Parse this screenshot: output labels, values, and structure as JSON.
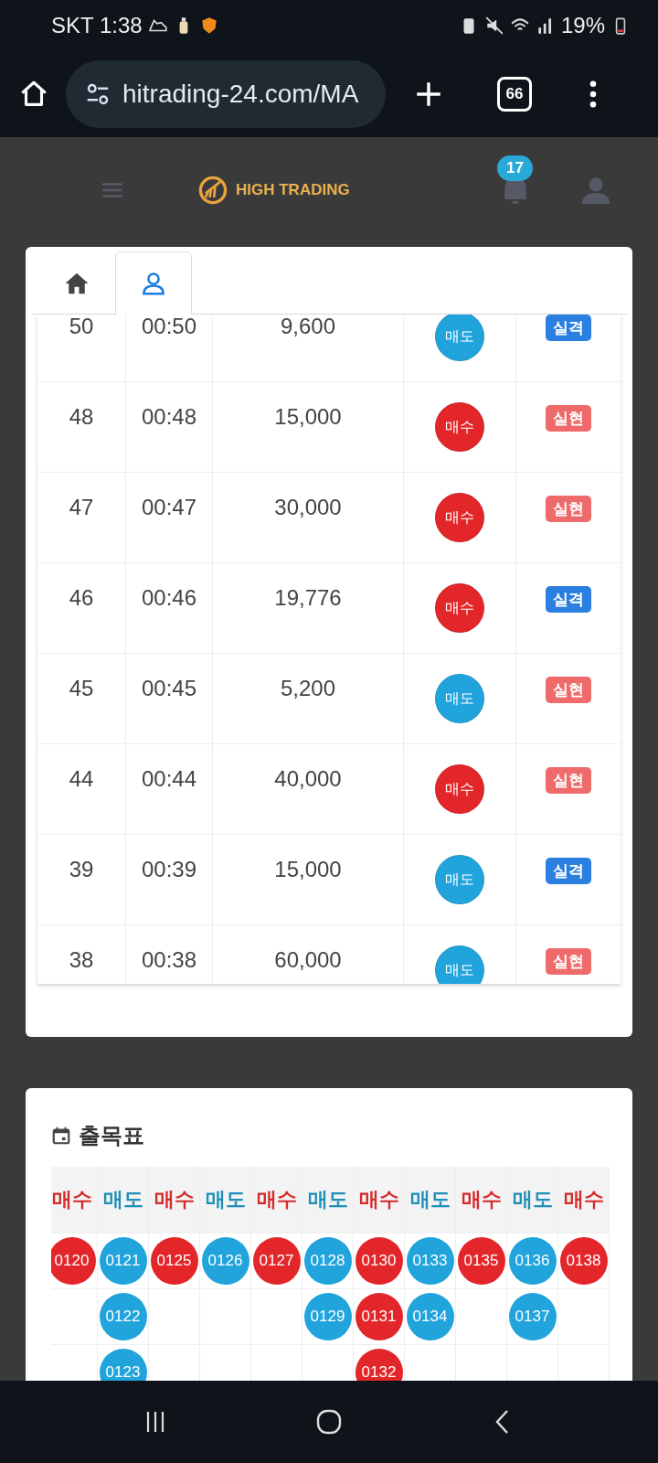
{
  "status_bar": {
    "carrier_time": "SKT 1:38",
    "battery": "19%"
  },
  "browser": {
    "url": "hitrading-24.com/MA",
    "tab_count": "66"
  },
  "header": {
    "brand": "HIGH TRADING",
    "notification_count": "17"
  },
  "tabs": [
    {
      "kind": "home",
      "selected": false
    },
    {
      "kind": "user",
      "selected": true
    }
  ],
  "trades": [
    {
      "no": "50",
      "time": "00:50",
      "amount": "9,600",
      "side": {
        "kind": "sell",
        "label": "매도"
      },
      "result": {
        "kind": "fail",
        "label": "실격"
      }
    },
    {
      "no": "48",
      "time": "00:48",
      "amount": "15,000",
      "side": {
        "kind": "buy",
        "label": "매수"
      },
      "result": {
        "kind": "hit",
        "label": "실현"
      }
    },
    {
      "no": "47",
      "time": "00:47",
      "amount": "30,000",
      "side": {
        "kind": "buy",
        "label": "매수"
      },
      "result": {
        "kind": "hit",
        "label": "실현"
      }
    },
    {
      "no": "46",
      "time": "00:46",
      "amount": "19,776",
      "side": {
        "kind": "buy",
        "label": "매수"
      },
      "result": {
        "kind": "fail",
        "label": "실격"
      }
    },
    {
      "no": "45",
      "time": "00:45",
      "amount": "5,200",
      "side": {
        "kind": "sell",
        "label": "매도"
      },
      "result": {
        "kind": "hit",
        "label": "실현"
      }
    },
    {
      "no": "44",
      "time": "00:44",
      "amount": "40,000",
      "side": {
        "kind": "buy",
        "label": "매수"
      },
      "result": {
        "kind": "hit",
        "label": "실현"
      }
    },
    {
      "no": "39",
      "time": "00:39",
      "amount": "15,000",
      "side": {
        "kind": "sell",
        "label": "매도"
      },
      "result": {
        "kind": "fail",
        "label": "실격"
      }
    },
    {
      "no": "38",
      "time": "00:38",
      "amount": "60,000",
      "side": {
        "kind": "sell",
        "label": "매도"
      },
      "result": {
        "kind": "hit",
        "label": "실현"
      }
    }
  ],
  "schedule": {
    "title": "출목표",
    "columns": [
      {
        "kind": "buy",
        "label": "매수",
        "cells": [
          "0120"
        ]
      },
      {
        "kind": "sell",
        "label": "매도",
        "cells": [
          "0121",
          "0122",
          "0123"
        ]
      },
      {
        "kind": "buy",
        "label": "매수",
        "cells": [
          "0125"
        ]
      },
      {
        "kind": "sell",
        "label": "매도",
        "cells": [
          "0126"
        ]
      },
      {
        "kind": "buy",
        "label": "매수",
        "cells": [
          "0127"
        ]
      },
      {
        "kind": "sell",
        "label": "매도",
        "cells": [
          "0128",
          "0129"
        ]
      },
      {
        "kind": "buy",
        "label": "매수",
        "cells": [
          "0130",
          "0131",
          "0132"
        ]
      },
      {
        "kind": "sell",
        "label": "매도",
        "cells": [
          "0133",
          "0134"
        ]
      },
      {
        "kind": "buy",
        "label": "매수",
        "cells": [
          "0135"
        ]
      },
      {
        "kind": "sell",
        "label": "매도",
        "cells": [
          "0136",
          "0137"
        ]
      },
      {
        "kind": "buy",
        "label": "매수",
        "cells": [
          "0138"
        ]
      }
    ]
  }
}
